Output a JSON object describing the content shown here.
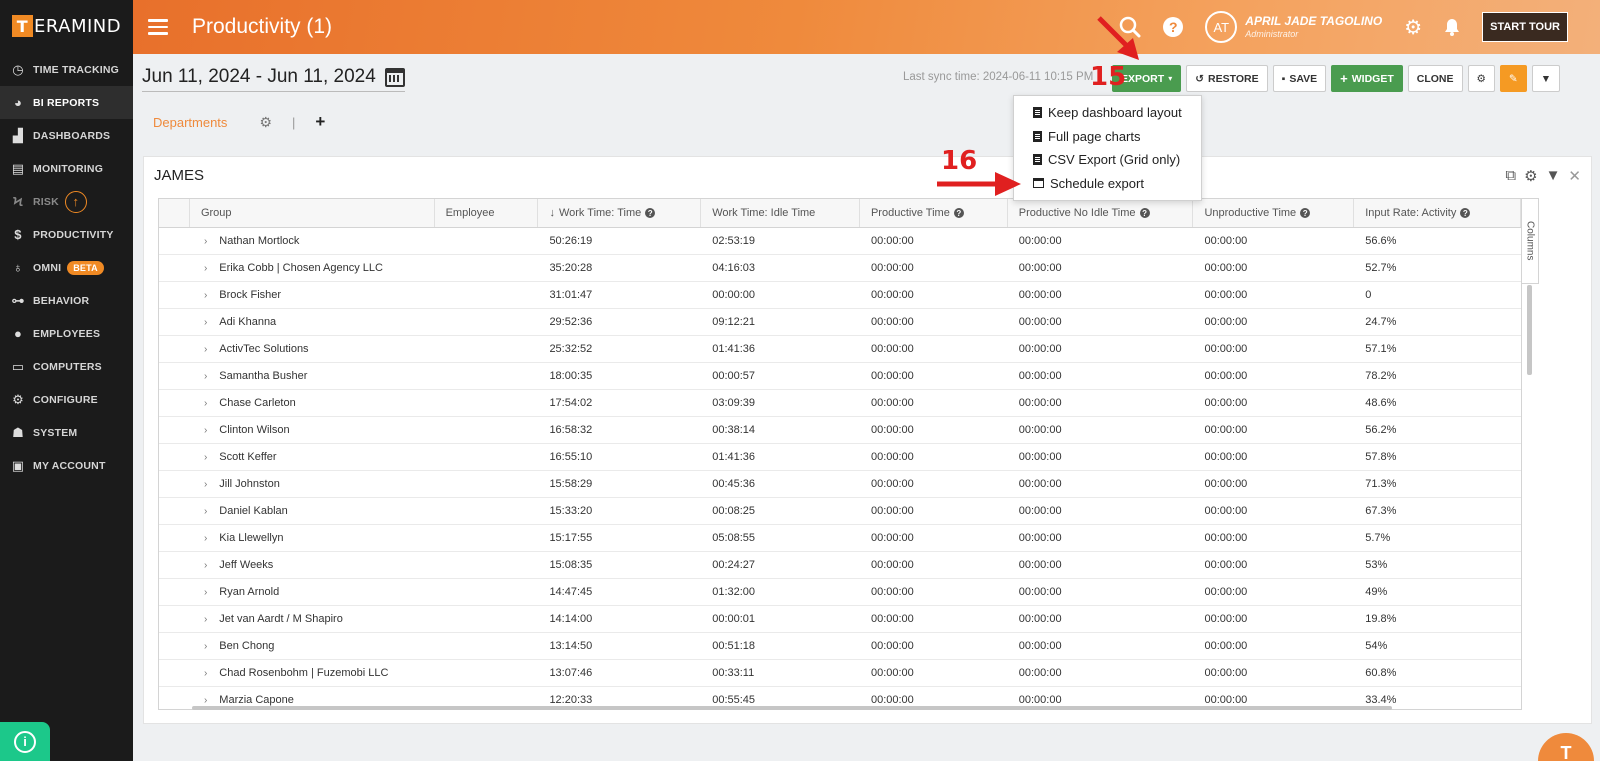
{
  "brand": {
    "logo_letter": "T",
    "logo_rest": "ERAMIND"
  },
  "sidebar": {
    "items": [
      {
        "label": "TIME TRACKING",
        "icon": "clock-icon"
      },
      {
        "label": "BI REPORTS",
        "icon": "pie-chart-icon"
      },
      {
        "label": "DASHBOARDS",
        "icon": "dashboard-chart-icon"
      },
      {
        "label": "MONITORING",
        "icon": "monitor-list-icon"
      },
      {
        "label": "RISK",
        "icon": "lightning-icon"
      },
      {
        "label": "PRODUCTIVITY",
        "icon": "dollar-icon"
      },
      {
        "label": "OMNI",
        "icon": "lightbulb-icon",
        "badge": "BETA"
      },
      {
        "label": "BEHAVIOR",
        "icon": "gamepad-icon"
      },
      {
        "label": "EMPLOYEES",
        "icon": "users-icon"
      },
      {
        "label": "COMPUTERS",
        "icon": "desktop-icon"
      },
      {
        "label": "CONFIGURE",
        "icon": "gear-icon"
      },
      {
        "label": "SYSTEM",
        "icon": "user-gear-icon"
      },
      {
        "label": "MY ACCOUNT",
        "icon": "account-card-icon"
      }
    ]
  },
  "topbar": {
    "title": "Productivity (1)",
    "avatar_initials": "AT",
    "user_name": "APRIL JADE TAGOLINO",
    "user_role": "Administrator",
    "start_tour": "START TOUR"
  },
  "main": {
    "date_range": "Jun 11, 2024 - Jun 11, 2024",
    "sync_label": "Last sync time: 2024-06-11 10:15 PM",
    "toolbar": {
      "export": "EXPORT",
      "restore": "RESTORE",
      "save": "SAVE",
      "widget": "WIDGET",
      "clone": "CLONE"
    },
    "tabs": {
      "departments": "Departments",
      "separator": "|",
      "add": "+"
    },
    "export_menu": [
      "Keep dashboard layout",
      "Full page charts",
      "CSV Export (Grid only)",
      "Schedule export"
    ],
    "widget": {
      "title": "JAMES",
      "columns_label": "Columns",
      "headers": [
        "Group",
        "Employee",
        "Work Time: Time",
        "Work Time: Idle Time",
        "Productive Time",
        "Productive No Idle Time",
        "Unproductive Time",
        "Input Rate: Activity"
      ],
      "rows": [
        [
          "Nathan Mortlock",
          "",
          "50:26:19",
          "02:53:19",
          "00:00:00",
          "00:00:00",
          "00:00:00",
          "56.6%"
        ],
        [
          "Erika Cobb | Chosen Agency LLC",
          "",
          "35:20:28",
          "04:16:03",
          "00:00:00",
          "00:00:00",
          "00:00:00",
          "52.7%"
        ],
        [
          "Brock Fisher",
          "",
          "31:01:47",
          "00:00:00",
          "00:00:00",
          "00:00:00",
          "00:00:00",
          "0"
        ],
        [
          "Adi Khanna",
          "",
          "29:52:36",
          "09:12:21",
          "00:00:00",
          "00:00:00",
          "00:00:00",
          "24.7%"
        ],
        [
          "ActivTec Solutions",
          "",
          "25:32:52",
          "01:41:36",
          "00:00:00",
          "00:00:00",
          "00:00:00",
          "57.1%"
        ],
        [
          "Samantha Busher",
          "",
          "18:00:35",
          "00:00:57",
          "00:00:00",
          "00:00:00",
          "00:00:00",
          "78.2%"
        ],
        [
          "Chase Carleton",
          "",
          "17:54:02",
          "03:09:39",
          "00:00:00",
          "00:00:00",
          "00:00:00",
          "48.6%"
        ],
        [
          "Clinton Wilson",
          "",
          "16:58:32",
          "00:38:14",
          "00:00:00",
          "00:00:00",
          "00:00:00",
          "56.2%"
        ],
        [
          "Scott Keffer",
          "",
          "16:55:10",
          "01:41:36",
          "00:00:00",
          "00:00:00",
          "00:00:00",
          "57.8%"
        ],
        [
          "Jill Johnston",
          "",
          "15:58:29",
          "00:45:36",
          "00:00:00",
          "00:00:00",
          "00:00:00",
          "71.3%"
        ],
        [
          "Daniel Kablan",
          "",
          "15:33:20",
          "00:08:25",
          "00:00:00",
          "00:00:00",
          "00:00:00",
          "67.3%"
        ],
        [
          "Kia Llewellyn",
          "",
          "15:17:55",
          "05:08:55",
          "00:00:00",
          "00:00:00",
          "00:00:00",
          "5.7%"
        ],
        [
          "Jeff Weeks",
          "",
          "15:08:35",
          "00:24:27",
          "00:00:00",
          "00:00:00",
          "00:00:00",
          "53%"
        ],
        [
          "Ryan Arnold",
          "",
          "14:47:45",
          "01:32:00",
          "00:00:00",
          "00:00:00",
          "00:00:00",
          "49%"
        ],
        [
          "Jet van Aardt / M Shapiro",
          "",
          "14:14:00",
          "00:00:01",
          "00:00:00",
          "00:00:00",
          "00:00:00",
          "19.8%"
        ],
        [
          "Ben Chong",
          "",
          "13:14:50",
          "00:51:18",
          "00:00:00",
          "00:00:00",
          "00:00:00",
          "54%"
        ],
        [
          "Chad Rosenbohm | Fuzemobi LLC",
          "",
          "13:07:46",
          "00:33:11",
          "00:00:00",
          "00:00:00",
          "00:00:00",
          "60.8%"
        ],
        [
          "Marzia Capone",
          "",
          "12:20:33",
          "00:55:45",
          "00:00:00",
          "00:00:00",
          "00:00:00",
          "33.4%"
        ]
      ]
    }
  },
  "annotations": {
    "step_a": "15",
    "step_b": "16"
  },
  "fab_letter": "T",
  "colors": {
    "accent": "#ef8a3c",
    "export_green": "#4a9c4f",
    "sidebar": "#1b1b1b",
    "annotation_red": "#e02020"
  }
}
